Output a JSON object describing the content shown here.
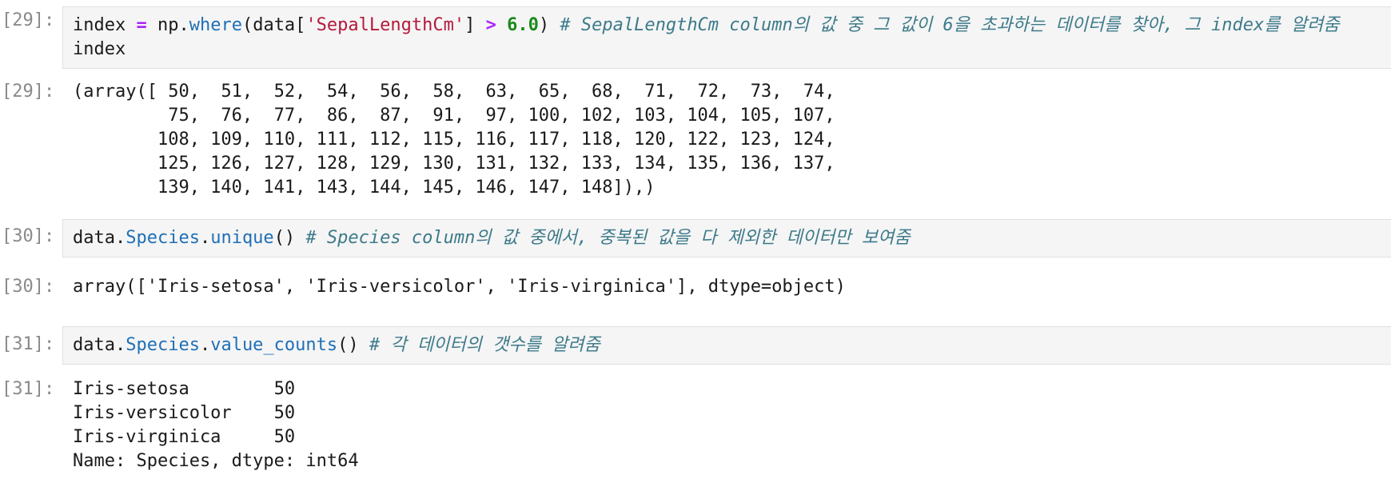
{
  "cells": [
    {
      "input_prompt": "[29]:",
      "input_lines": [
        {
          "tokens": [
            {
              "cls": "plain",
              "text": "index "
            },
            {
              "cls": "op",
              "text": "="
            },
            {
              "cls": "plain",
              "text": " np."
            },
            {
              "cls": "fn",
              "text": "where"
            },
            {
              "cls": "plain",
              "text": "(data["
            },
            {
              "cls": "str",
              "text": "'SepalLengthCm'"
            },
            {
              "cls": "plain",
              "text": "] "
            },
            {
              "cls": "op",
              "text": ">"
            },
            {
              "cls": "plain",
              "text": " "
            },
            {
              "cls": "num",
              "text": "6.0"
            },
            {
              "cls": "plain",
              "text": ") "
            },
            {
              "cls": "cmt",
              "text": "# SepalLengthCm column의 값 중 그 값이 6을 초과하는 데이터를 찾아, 그 index를 알려줌"
            }
          ]
        },
        {
          "tokens": [
            {
              "cls": "plain",
              "text": "index"
            }
          ]
        }
      ],
      "output_prompt": "[29]:",
      "output_lines": [
        "(array([ 50,  51,  52,  54,  56,  58,  63,  65,  68,  71,  72,  73,  74,",
        "         75,  76,  77,  86,  87,  91,  97, 100, 102, 103, 104, 105, 107,",
        "        108, 109, 110, 111, 112, 115, 116, 117, 118, 120, 122, 123, 124,",
        "        125, 126, 127, 128, 129, 130, 131, 132, 133, 134, 135, 136, 137,",
        "        139, 140, 141, 143, 144, 145, 146, 147, 148]),)"
      ]
    },
    {
      "input_prompt": "[30]:",
      "input_lines": [
        {
          "tokens": [
            {
              "cls": "plain",
              "text": "data."
            },
            {
              "cls": "fn",
              "text": "Species"
            },
            {
              "cls": "plain",
              "text": "."
            },
            {
              "cls": "fn",
              "text": "unique"
            },
            {
              "cls": "plain",
              "text": "() "
            },
            {
              "cls": "cmt",
              "text": "# Species column의 값 중에서, 중복된 값을 다 제외한 데이터만 보여줌"
            }
          ]
        }
      ],
      "output_prompt": "[30]:",
      "output_lines": [
        "array(['Iris-setosa', 'Iris-versicolor', 'Iris-virginica'], dtype=object)"
      ]
    },
    {
      "input_prompt": "[31]:",
      "input_lines": [
        {
          "tokens": [
            {
              "cls": "plain",
              "text": "data."
            },
            {
              "cls": "fn",
              "text": "Species"
            },
            {
              "cls": "plain",
              "text": "."
            },
            {
              "cls": "fn",
              "text": "value_counts"
            },
            {
              "cls": "plain",
              "text": "() "
            },
            {
              "cls": "cmt",
              "text": "# 각 데이터의 갯수를 알려줌"
            }
          ]
        }
      ],
      "output_prompt": "[31]:",
      "output_lines": [
        "Iris-setosa        50",
        "Iris-versicolor    50",
        "Iris-virginica     50",
        "Name: Species, dtype: int64"
      ]
    }
  ]
}
